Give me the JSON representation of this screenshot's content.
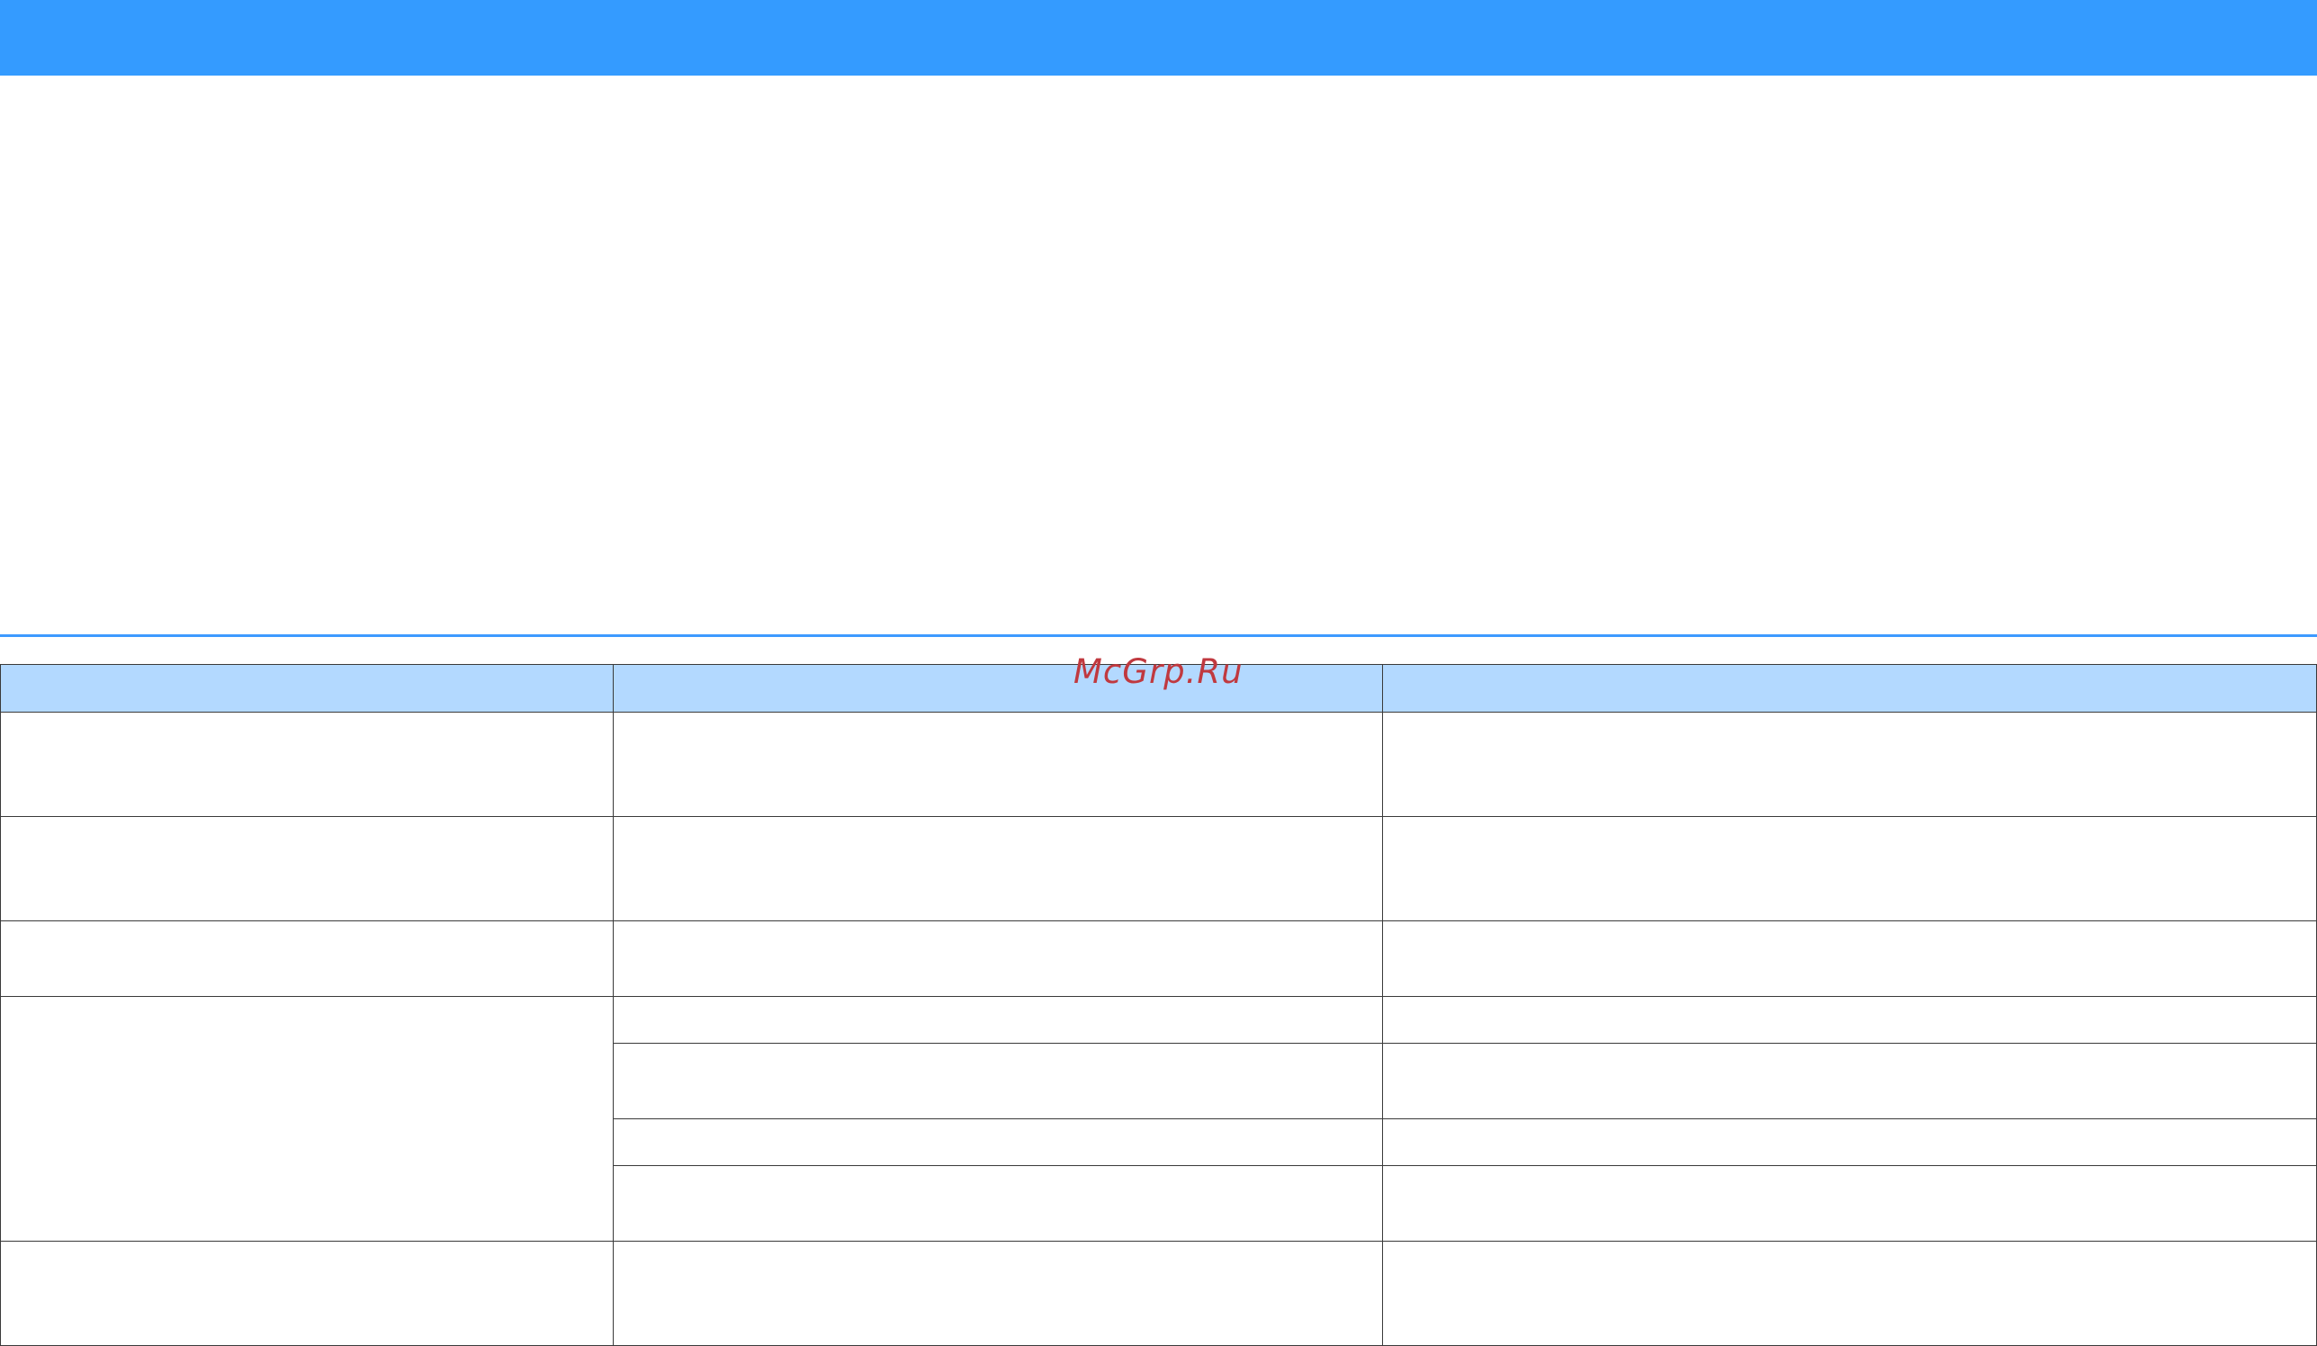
{
  "header_bar": {
    "color": "#349bff"
  },
  "watermark": {
    "text": "McGrp.Ru",
    "color": "#c0393f"
  },
  "table": {
    "header_color": "#b3d9ff",
    "header": [
      "",
      "",
      ""
    ],
    "rows": [
      [
        "",
        "",
        ""
      ],
      [
        "",
        "",
        ""
      ],
      [
        "",
        "",
        ""
      ],
      [
        "",
        "",
        ""
      ],
      [
        "",
        "",
        ""
      ],
      [
        "",
        "",
        ""
      ],
      [
        "",
        "",
        ""
      ],
      [
        "",
        "",
        ""
      ]
    ]
  }
}
